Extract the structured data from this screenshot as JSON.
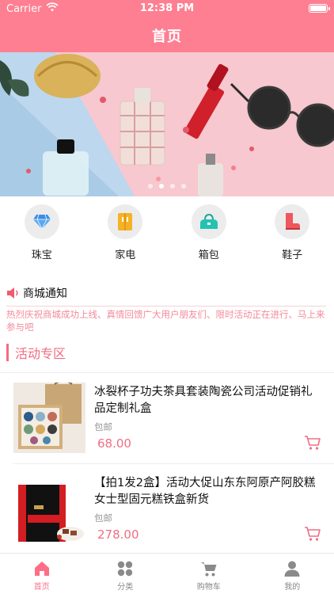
{
  "status_bar": {
    "carrier": "Carrier",
    "time": "12:38 PM"
  },
  "header": {
    "title": "首页"
  },
  "banner": {
    "slide_count": 4,
    "active_slide": 2
  },
  "categories": [
    {
      "label": "珠宝",
      "icon": "diamond-icon"
    },
    {
      "label": "家电",
      "icon": "fridge-icon"
    },
    {
      "label": "箱包",
      "icon": "bag-icon"
    },
    {
      "label": "鞋子",
      "icon": "boot-icon"
    }
  ],
  "notice": {
    "title": "商城通知",
    "text": "热烈庆祝商城成功上线、真情回馈广大用户朋友们、限时活动正在进行、马上来参与吧"
  },
  "section": {
    "title": "活动专区"
  },
  "products": [
    {
      "name": "冰裂杯子功夫茶具套装陶瓷公司活动促销礼品定制礼盒",
      "shipping": "包邮",
      "price": "68.00"
    },
    {
      "name": "【拍1发2盒】活动大促山东东阿原产阿胶糕女士型固元糕铁盒新货",
      "shipping": "包邮",
      "price": "278.00"
    }
  ],
  "tabbar": [
    {
      "label": "首页",
      "icon": "home-icon",
      "active": true
    },
    {
      "label": "分类",
      "icon": "grid-icon",
      "active": false
    },
    {
      "label": "购物车",
      "icon": "cart-icon",
      "active": false
    },
    {
      "label": "我的",
      "icon": "person-icon",
      "active": false
    }
  ],
  "colors": {
    "accent": "#fd7f91",
    "price": "#f06f82",
    "notice_text": "#f48a9a"
  }
}
